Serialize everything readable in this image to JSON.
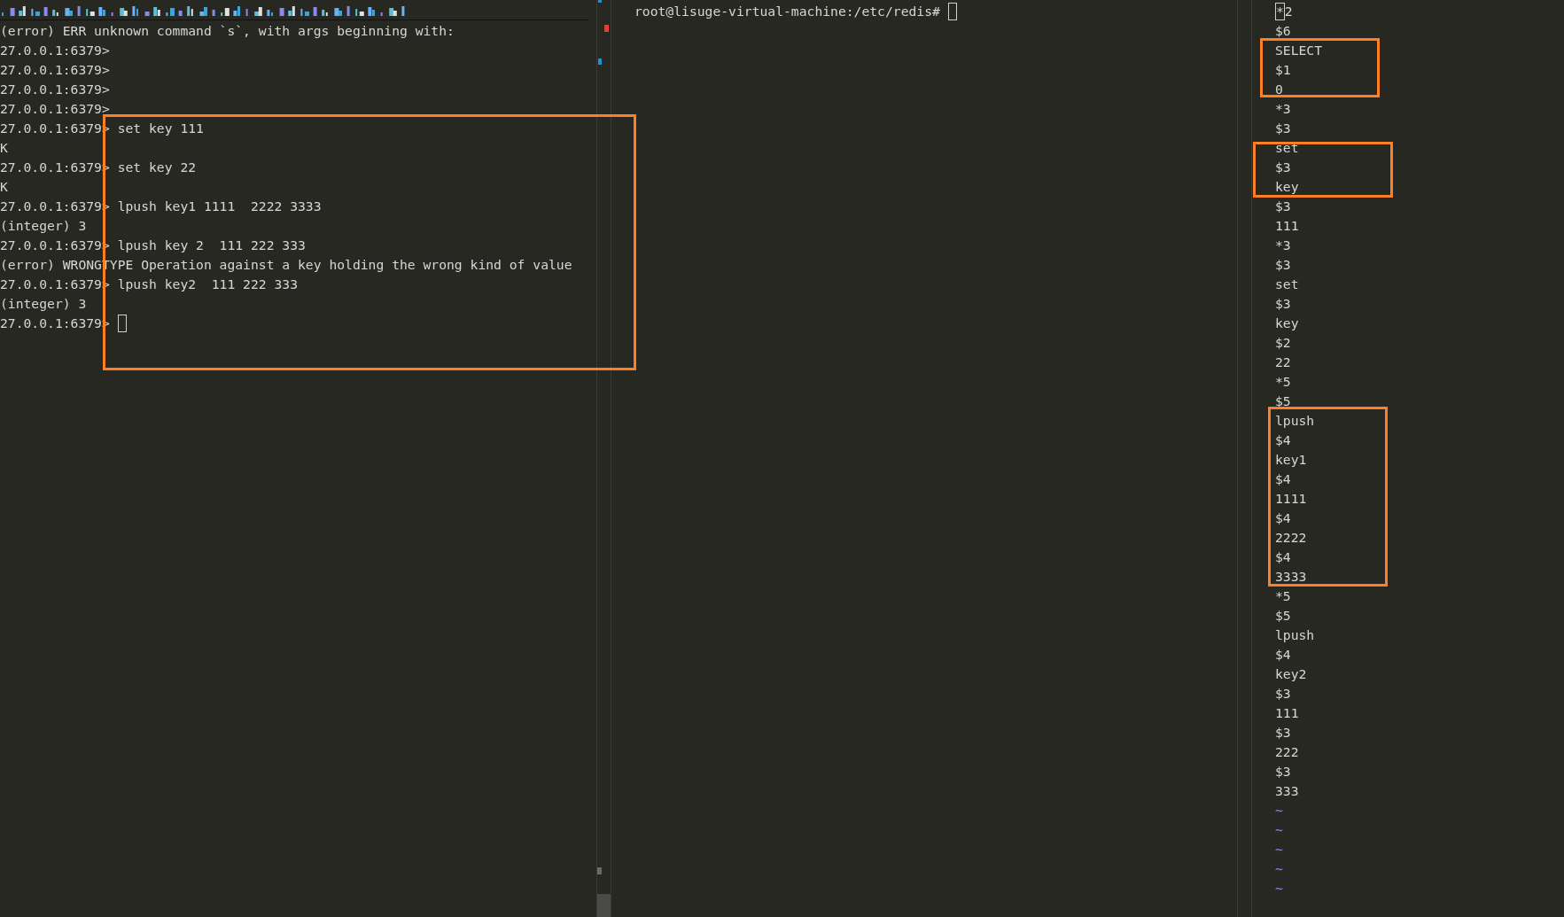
{
  "left_pane": {
    "lines": [
      {
        "text": "(error) ERR unknown command `s`, with args beginning with:",
        "cursor": false
      },
      {
        "text": "27.0.0.1:6379>",
        "cursor": false
      },
      {
        "text": "27.0.0.1:6379>",
        "cursor": false
      },
      {
        "text": "27.0.0.1:6379>",
        "cursor": false
      },
      {
        "text": "27.0.0.1:6379>",
        "cursor": false
      },
      {
        "text": "27.0.0.1:6379> set key 111",
        "cursor": false
      },
      {
        "text": "K",
        "cursor": false
      },
      {
        "text": "27.0.0.1:6379> set key 22",
        "cursor": false
      },
      {
        "text": "K",
        "cursor": false
      },
      {
        "text": "27.0.0.1:6379> lpush key1 1111  2222 3333",
        "cursor": false
      },
      {
        "text": "(integer) 3",
        "cursor": false
      },
      {
        "text": "27.0.0.1:6379> lpush key 2  111 222 333",
        "cursor": false
      },
      {
        "text": "(error) WRONGTYPE Operation against a key holding the wrong kind of value",
        "cursor": false
      },
      {
        "text": "27.0.0.1:6379> lpush key2  111 222 333",
        "cursor": false
      },
      {
        "text": "(integer) 3",
        "cursor": false
      },
      {
        "text": "27.0.0.1:6379>",
        "cursor": true
      }
    ]
  },
  "middle_pane": {
    "lines": [
      {
        "text": "root@lisuge-virtual-machine:/etc/redis#",
        "cursor": true
      }
    ]
  },
  "right_pane": {
    "lines": [
      {
        "kind": "text",
        "text": "*2",
        "cursor": true
      },
      {
        "kind": "text",
        "text": "$6",
        "cursor": false
      },
      {
        "kind": "text",
        "text": "SELECT",
        "cursor": false
      },
      {
        "kind": "text",
        "text": "$1",
        "cursor": false
      },
      {
        "kind": "text",
        "text": "0",
        "cursor": false
      },
      {
        "kind": "text",
        "text": "*3",
        "cursor": false
      },
      {
        "kind": "text",
        "text": "$3",
        "cursor": false
      },
      {
        "kind": "text",
        "text": "set",
        "cursor": false
      },
      {
        "kind": "text",
        "text": "$3",
        "cursor": false
      },
      {
        "kind": "text",
        "text": "key",
        "cursor": false
      },
      {
        "kind": "text",
        "text": "$3",
        "cursor": false
      },
      {
        "kind": "text",
        "text": "111",
        "cursor": false
      },
      {
        "kind": "text",
        "text": "*3",
        "cursor": false
      },
      {
        "kind": "text",
        "text": "$3",
        "cursor": false
      },
      {
        "kind": "text",
        "text": "set",
        "cursor": false
      },
      {
        "kind": "text",
        "text": "$3",
        "cursor": false
      },
      {
        "kind": "text",
        "text": "key",
        "cursor": false
      },
      {
        "kind": "text",
        "text": "$2",
        "cursor": false
      },
      {
        "kind": "text",
        "text": "22",
        "cursor": false
      },
      {
        "kind": "text",
        "text": "*5",
        "cursor": false
      },
      {
        "kind": "text",
        "text": "$5",
        "cursor": false
      },
      {
        "kind": "text",
        "text": "lpush",
        "cursor": false
      },
      {
        "kind": "text",
        "text": "$4",
        "cursor": false
      },
      {
        "kind": "text",
        "text": "key1",
        "cursor": false
      },
      {
        "kind": "text",
        "text": "$4",
        "cursor": false
      },
      {
        "kind": "text",
        "text": "1111",
        "cursor": false
      },
      {
        "kind": "text",
        "text": "$4",
        "cursor": false
      },
      {
        "kind": "text",
        "text": "2222",
        "cursor": false
      },
      {
        "kind": "text",
        "text": "$4",
        "cursor": false
      },
      {
        "kind": "text",
        "text": "3333",
        "cursor": false
      },
      {
        "kind": "text",
        "text": "*5",
        "cursor": false
      },
      {
        "kind": "text",
        "text": "$5",
        "cursor": false
      },
      {
        "kind": "text",
        "text": "lpush",
        "cursor": false
      },
      {
        "kind": "text",
        "text": "$4",
        "cursor": false
      },
      {
        "kind": "text",
        "text": "key2",
        "cursor": false
      },
      {
        "kind": "text",
        "text": "$3",
        "cursor": false
      },
      {
        "kind": "text",
        "text": "111",
        "cursor": false
      },
      {
        "kind": "text",
        "text": "$3",
        "cursor": false
      },
      {
        "kind": "text",
        "text": "222",
        "cursor": false
      },
      {
        "kind": "text",
        "text": "$3",
        "cursor": false
      },
      {
        "kind": "text",
        "text": "333",
        "cursor": false
      },
      {
        "kind": "filler",
        "text": "~",
        "cursor": false
      },
      {
        "kind": "filler",
        "text": "~",
        "cursor": false
      },
      {
        "kind": "filler",
        "text": "~",
        "cursor": false
      },
      {
        "kind": "filler",
        "text": "~",
        "cursor": false
      },
      {
        "kind": "filler",
        "text": "~",
        "cursor": false
      }
    ]
  }
}
